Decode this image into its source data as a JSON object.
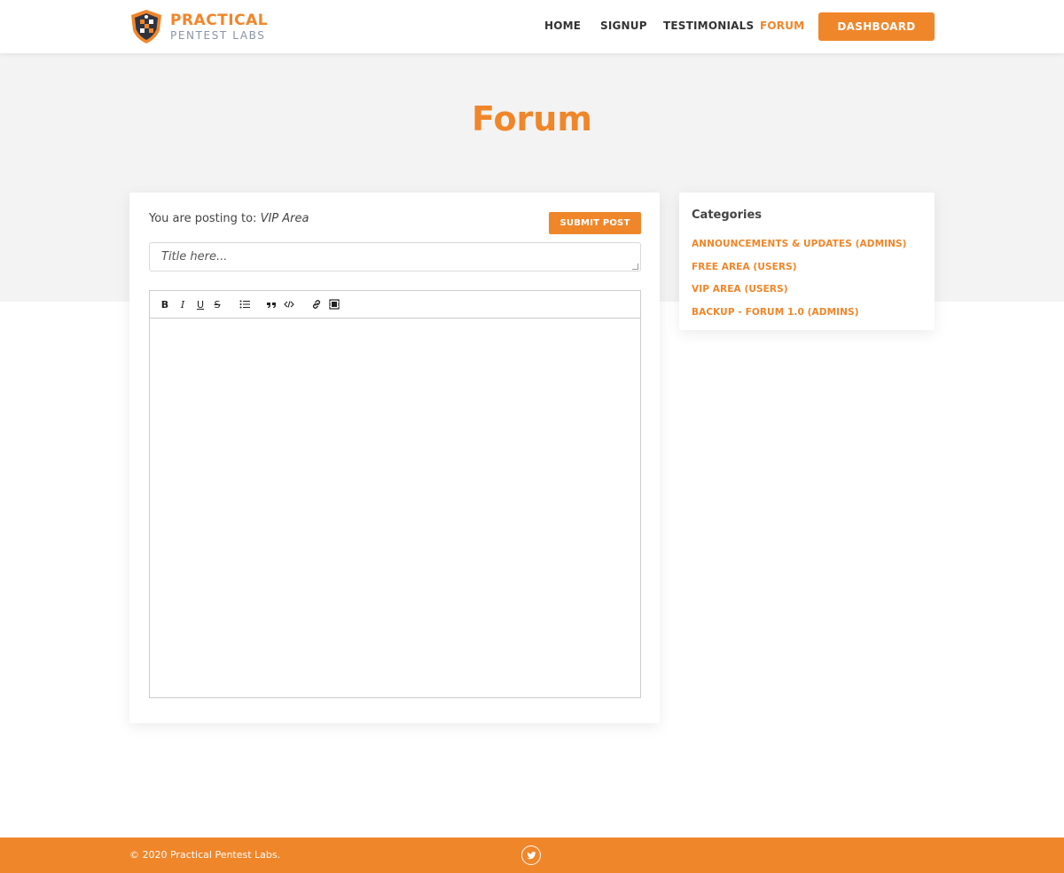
{
  "brand": {
    "name_top": "PRACTICAL",
    "name_bottom": "PENTEST LABS",
    "accent_color": "#f0862a",
    "logo_icon": "shield-logo-icon"
  },
  "nav": {
    "items": [
      {
        "label": "HOME",
        "active": false
      },
      {
        "label": "SIGNUP",
        "active": false
      },
      {
        "label": "TESTIMONIALS",
        "active": false
      },
      {
        "label": "FORUM",
        "active": true
      }
    ],
    "dashboard_label": "DASHBOARD"
  },
  "page": {
    "title": "Forum"
  },
  "post_form": {
    "posting_to_label": "You are posting to:",
    "posting_to_value": "VIP Area",
    "submit_label": "SUBMIT POST",
    "title_placeholder": "Title here...",
    "title_value": "",
    "toolbar": [
      {
        "name": "bold-icon",
        "glyph": "B"
      },
      {
        "name": "italic-icon",
        "glyph": "I"
      },
      {
        "name": "underline-icon",
        "glyph": "U"
      },
      {
        "name": "strikethrough-icon",
        "glyph": "S"
      },
      {
        "name": "bullet-list-icon",
        "glyph": ""
      },
      {
        "name": "quote-icon",
        "glyph": ""
      },
      {
        "name": "code-icon",
        "glyph": ""
      },
      {
        "name": "link-icon",
        "glyph": ""
      },
      {
        "name": "video-icon",
        "glyph": ""
      }
    ],
    "body_value": ""
  },
  "categories": {
    "heading": "Categories",
    "items": [
      {
        "label": "ANNOUNCEMENTS & UPDATES (ADMINS)"
      },
      {
        "label": "FREE AREA (USERS)"
      },
      {
        "label": "VIP AREA (USERS)"
      },
      {
        "label": "BACKUP - FORUM 1.0 (ADMINS)"
      }
    ]
  },
  "footer": {
    "copyright": "© 2020 Practical Pentest Labs.",
    "social_icon": "twitter-icon"
  }
}
